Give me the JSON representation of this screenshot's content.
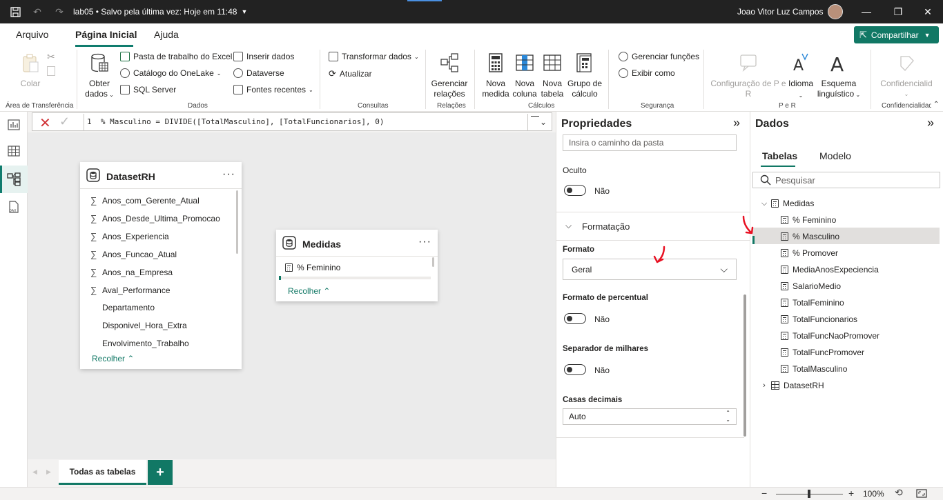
{
  "titlebar": {
    "file_title": "lab05 • Salvo pela última vez: Hoje em 11:48",
    "user_name": "Joao Vitor Luz Campos"
  },
  "menu": {
    "tabs": [
      "Arquivo",
      "Página Inicial",
      "Ajuda"
    ],
    "share_label": "Compartilhar"
  },
  "ribbon": {
    "clipboard": {
      "paste": "Colar",
      "group": "Área de Transferência"
    },
    "data": {
      "get_data": "Obter",
      "get_data2": "dados",
      "excel": "Pasta de trabalho do Excel",
      "onelake": "Catálogo do OneLake",
      "sql": "SQL Server",
      "insert": "Inserir dados",
      "dataverse": "Dataverse",
      "recent": "Fontes recentes",
      "group": "Dados"
    },
    "queries": {
      "transform": "Transformar dados",
      "refresh": "Atualizar",
      "group": "Consultas"
    },
    "relations": {
      "manage1": "Gerenciar",
      "manage2": "relações",
      "group": "Relações"
    },
    "calc": {
      "measure1": "Nova",
      "measure2": "medida",
      "column1": "Nova",
      "column2": "coluna",
      "table1": "Nova",
      "table2": "tabela",
      "calcgroup1": "Grupo de",
      "calcgroup2": "cálculo",
      "group": "Cálculos"
    },
    "security": {
      "manage_roles": "Gerenciar funções",
      "view_as": "Exibir como",
      "group": "Segurança"
    },
    "qa": {
      "setup1": "Configuração de P e",
      "setup2": "R",
      "language": "Idioma",
      "schema1": "Esquema",
      "schema2": "linguístico",
      "group": "P e R"
    },
    "sensitivity": {
      "label": "Confidencialid",
      "group": "Confidencialidad"
    }
  },
  "formula": {
    "text": "1  % Masculino = DIVIDE([TotalMasculino], [TotalFuncionarios], 0)"
  },
  "canvas": {
    "dataset_card": {
      "title": "DatasetRH",
      "fields": [
        {
          "name": "Anos_com_Gerente_Atual",
          "sigma": "∑"
        },
        {
          "name": "Anos_Desde_Ultima_Promocao",
          "sigma": "∑"
        },
        {
          "name": "Anos_Experiencia",
          "sigma": "∑"
        },
        {
          "name": "Anos_Funcao_Atual",
          "sigma": "∑"
        },
        {
          "name": "Anos_na_Empresa",
          "sigma": "∑"
        },
        {
          "name": "Aval_Performance",
          "sigma": "∑"
        },
        {
          "name": "Departamento",
          "sigma": ""
        },
        {
          "name": "Disponivel_Hora_Extra",
          "sigma": ""
        },
        {
          "name": "Envolvimento_Trabalho",
          "sigma": ""
        }
      ],
      "collapse": "Recolher"
    },
    "measures_card": {
      "title": "Medidas",
      "fields": [
        "% Feminino"
      ],
      "collapse": "Recolher"
    },
    "page_tab": "Todas as tabelas",
    "add_page": "+"
  },
  "properties": {
    "title": "Propriedades",
    "folder_placeholder": "Insira o caminho da pasta",
    "hidden_label": "Oculto",
    "hidden_value": "Não",
    "formatting_section": "Formatação",
    "format_label": "Formato",
    "format_value": "Geral",
    "percent_label": "Formato de percentual",
    "percent_value": "Não",
    "thousands_label": "Separador de milhares",
    "thousands_value": "Não",
    "decimals_label": "Casas decimais",
    "decimals_value": "Auto"
  },
  "data_pane": {
    "title": "Dados",
    "tabs": [
      "Tabelas",
      "Modelo"
    ],
    "search_placeholder": "Pesquisar",
    "tables": [
      {
        "name": "Medidas",
        "items": [
          "% Feminino",
          "% Masculino",
          "% Promover",
          "MediaAnosExpeciencia",
          "SalarioMedio",
          "TotalFeminino",
          "TotalFuncionarios",
          "TotalFuncNaoPromover",
          "TotalFuncPromover",
          "TotalMasculino"
        ]
      },
      {
        "name": "DatasetRH",
        "items": []
      }
    ],
    "selected_item": "% Masculino"
  },
  "status": {
    "zoom": "100%"
  },
  "colors": {
    "accent": "#117865",
    "annotation": "#e81123"
  }
}
